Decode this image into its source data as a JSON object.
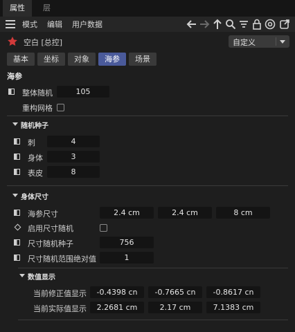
{
  "tabs": [
    "属性",
    "层"
  ],
  "menu": {
    "items": [
      "模式",
      "编辑",
      "用户数据"
    ],
    "toolbar": [
      "back-arrow-icon",
      "forward-arrow-icon",
      "up-arrow-icon",
      "search-icon",
      "filter-icon",
      "lock-icon",
      "target-icon",
      "new-window-icon"
    ]
  },
  "object": {
    "name": "空白 [总控]",
    "mode_dropdown": "自定义"
  },
  "subtabs": [
    "基本",
    "坐标",
    "对象",
    "海参",
    "场景"
  ],
  "active_subtab": "海参",
  "section_title": "海参",
  "top_params": {
    "overall_random_label": "整体随机",
    "overall_random_value": "105",
    "rebuild_mesh_label": "重构网格"
  },
  "random_seed": {
    "title": "随机种子",
    "rows": [
      {
        "label": "刺",
        "value": "4"
      },
      {
        "label": "身体",
        "value": "3"
      },
      {
        "label": "表皮",
        "value": "8"
      }
    ]
  },
  "body_size": {
    "title": "身体尺寸",
    "size_label": "海参尺寸",
    "size_values": [
      "2.4 cm",
      "2.4 cm",
      "8 cm"
    ],
    "enable_random_label": "启用尺寸随机",
    "size_seed_label": "尺寸随机种子",
    "size_seed_value": "756",
    "range_abs_label": "尺寸随机范围绝对值",
    "range_abs_value": "1"
  },
  "value_display": {
    "title": "数值显示",
    "corr_label": "当前修正值显示",
    "corr_values": [
      "-0.4398 cn",
      "-0.7665 cn",
      "-0.8617 cn"
    ],
    "actual_label": "当前实际值显示",
    "actual_values": [
      "2.2681 cm",
      "2.17 cm",
      "7.1383 cm"
    ]
  },
  "colors": {
    "accent": "#4a5a9a",
    "star": "#d23a3a"
  }
}
